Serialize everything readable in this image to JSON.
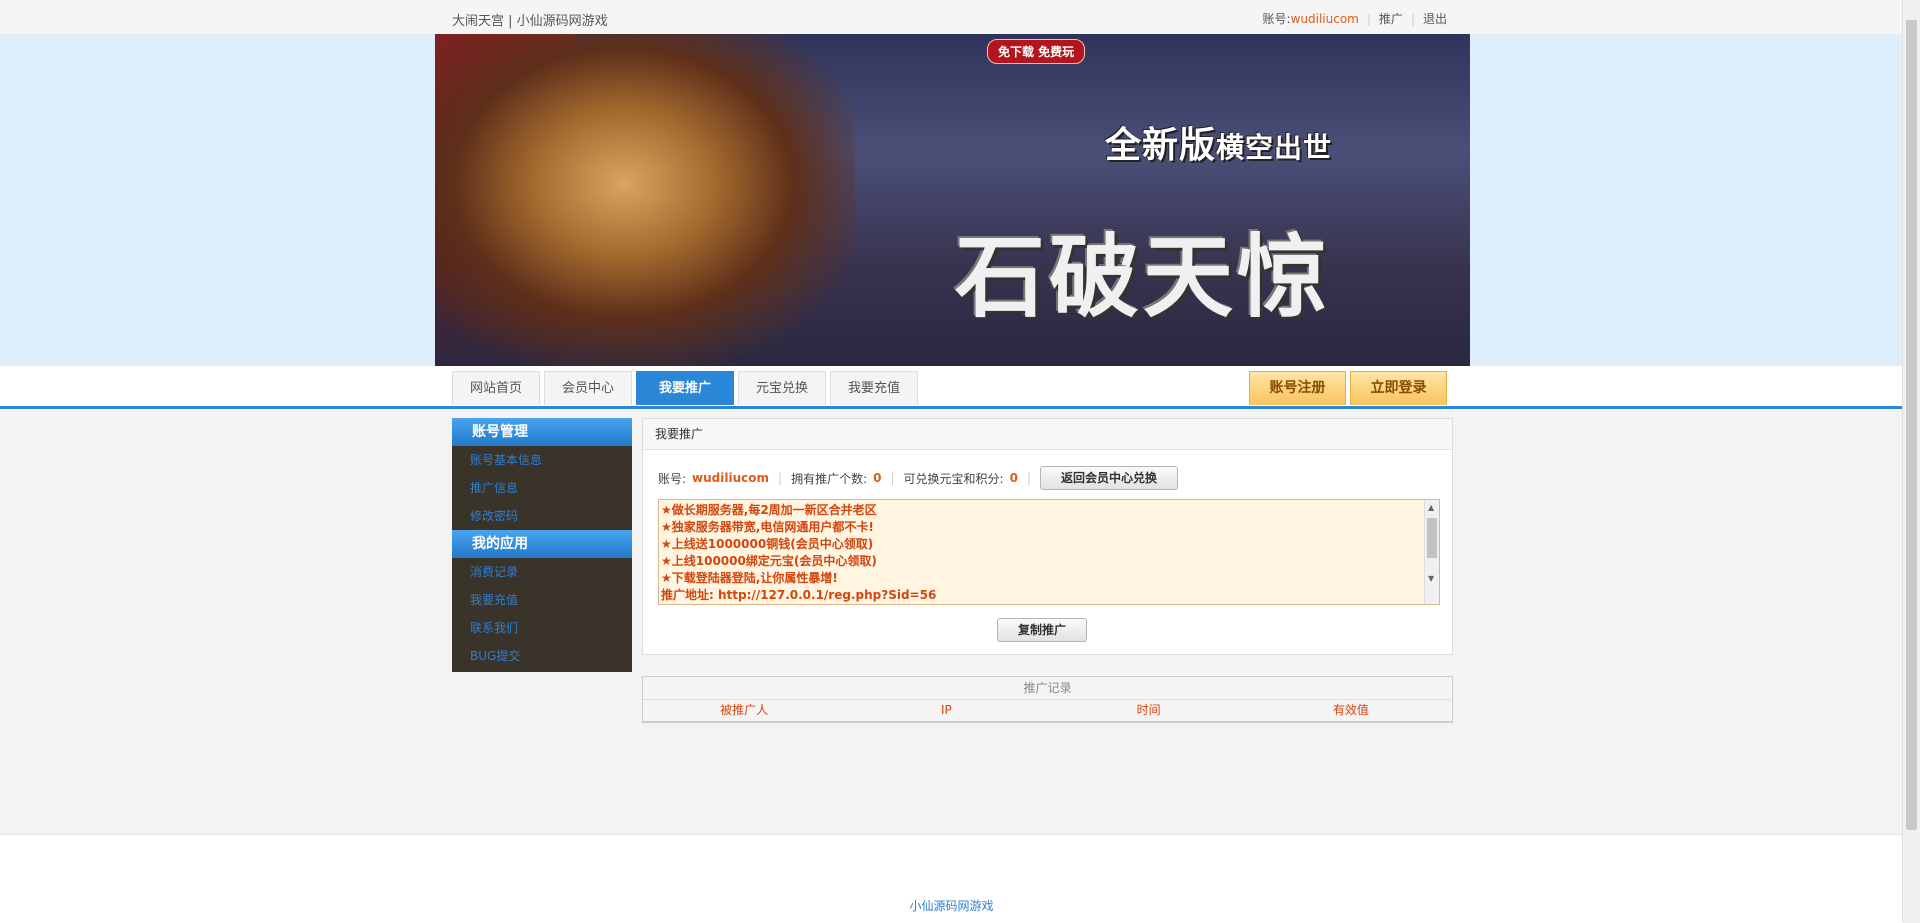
{
  "topbar": {
    "site_title": "大闹天宫 | 小仙源码网游戏",
    "account_label": "账号:",
    "account_name": "wudiliucom",
    "link_promote": "推广",
    "link_logout": "退出"
  },
  "banner": {
    "tag": "免下载 免费玩",
    "headline_a": "全新版",
    "headline_b": "横空出世",
    "big_title": "石破天惊"
  },
  "nav": {
    "tabs": [
      {
        "label": "网站首页"
      },
      {
        "label": "会员中心"
      },
      {
        "label": "我要推广",
        "active": true
      },
      {
        "label": "元宝兑换"
      },
      {
        "label": "我要充值"
      }
    ],
    "register": "账号注册",
    "login": "立即登录"
  },
  "sidebar": {
    "section1": "账号管理",
    "items1": [
      "账号基本信息",
      "推广信息",
      "修改密码"
    ],
    "section2": "我的应用",
    "items2": [
      "消费记录",
      "我要充值",
      "联系我们",
      "BUG提交"
    ]
  },
  "panel": {
    "title": "我要推广",
    "account_label": "账号:",
    "account_value": "wudiliucom",
    "promo_count_label": "拥有推广个数:",
    "promo_count_value": "0",
    "redeem_label": "可兑换元宝和积分:",
    "redeem_value": "0",
    "back_button": "返回会员中心兑换",
    "text_lines": [
      "★做长期服务器,每2周加一新区合并老区",
      "★独家服务器带宽,电信网通用户都不卡!",
      "★上线送1000000铜钱(会员中心领取)",
      "★上线100000绑定元宝(会员中心领取)",
      "★下载登陆器登陆,让你属性暴增!",
      "推广地址: http://127.0.0.1/reg.php?Sid=56"
    ],
    "copy_button": "复制推广"
  },
  "records": {
    "title": "推广记录",
    "columns": [
      "被推广人",
      "IP",
      "时间",
      "有效值"
    ]
  },
  "footer": {
    "text": "小仙源码网游戏"
  }
}
